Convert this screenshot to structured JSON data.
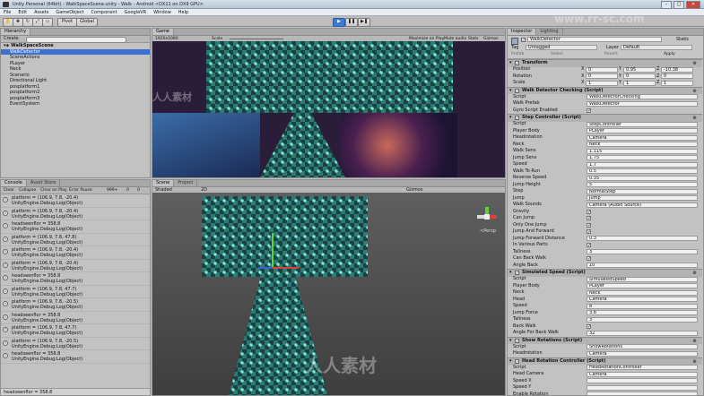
{
  "window": {
    "title": "Unity Personal (64bit) - WalkSpaceScene.unity - Walk - Android <DX11 on DX9 GPU>"
  },
  "menu": [
    "File",
    "Edit",
    "Assets",
    "GameObject",
    "Component",
    "GoogleVR",
    "Window",
    "Help"
  ],
  "toolbar": {
    "pivot": "Pivot",
    "global": "Global",
    "layers": "Layers",
    "layout": "Layout"
  },
  "hierarchy": {
    "tab": "Hierarchy",
    "create": "Create",
    "scene": "WalkSpaceScene",
    "items": [
      "WalkDetector",
      "SceneActions",
      "PLayer",
      "Neck",
      "Scenario",
      "Directional Light",
      "posplatform1",
      "posplatform2",
      "posplatform3",
      "EventSystem"
    ]
  },
  "game": {
    "tab": "Game",
    "display": "Display 1",
    "res": "1920x1080",
    "scale": "Scale",
    "maximize": "Maximize on Play",
    "mute": "Mute audio",
    "stats": "Stats",
    "gizmos": "Gizmos"
  },
  "scene_view": {
    "tab": "Scene",
    "tab2": "Project",
    "shaded": "Shaded",
    "mode": "2D",
    "gizmos": "Gizmos",
    "persp": "<Persp"
  },
  "console": {
    "tab": "Console",
    "tab2": "Asset Store",
    "buttons": [
      "Clear",
      "Collapse",
      "Clear on Play",
      "Error Pause"
    ],
    "counts": [
      "999+",
      "0",
      "0"
    ],
    "entries": [
      {
        "a": "platform = (106.9, 7.8, -20.4)",
        "b": "UnityEngine.Debug:Log(Object)"
      },
      {
        "a": "platform = (106.9, 7.8, -20.4)",
        "b": "UnityEngine.Debug:Log(Object)"
      },
      {
        "a": "headseenflor = 358.8",
        "b": "UnityEngine.Debug:Log(Object)"
      },
      {
        "a": "platform = (106.9, 7.8, 47.8)",
        "b": "UnityEngine.Debug:Log(Object)"
      },
      {
        "a": "platform = (106.9, 7.8, -20.4)",
        "b": "UnityEngine.Debug:Log(Object)"
      },
      {
        "a": "platform = (106.9, 7.8, -20.4)",
        "b": "UnityEngine.Debug:Log(Object)"
      },
      {
        "a": "headseenflor = 358.8",
        "b": "UnityEngine.Debug:Log(Object)"
      },
      {
        "a": "platform = (106.9, 7.8, 47.7)",
        "b": "UnityEngine.Debug:Log(Object)"
      },
      {
        "a": "platform = (106.9, 7.8, -20.5)",
        "b": "UnityEngine.Debug:Log(Object)"
      },
      {
        "a": "headseenflor = 358.8",
        "b": "UnityEngine.Debug:Log(Object)"
      },
      {
        "a": "platform = (106.9, 7.8, 47.7)",
        "b": "UnityEngine.Debug:Log(Object)"
      },
      {
        "a": "platform = (106.9, 7.8, -20.5)",
        "b": "UnityEngine.Debug:Log(Object)"
      },
      {
        "a": "headseenflor = 358.8",
        "b": "UnityEngine.Debug:Log(Object)"
      }
    ],
    "status": "headseenflor = 358.8"
  },
  "inspector": {
    "tab": "Inspector",
    "tab2": "Lighting",
    "object": "WalkDetector",
    "static": "Static",
    "tag_label": "Tag",
    "tag": "Untagged",
    "layer_label": "Layer",
    "layer": "Default",
    "prefab": "Prefab",
    "select": "Select",
    "revert": "Revert",
    "apply": "Apply",
    "transform": {
      "title": "Transform",
      "rows": [
        {
          "label": "Position",
          "x": "0",
          "y": "0.95",
          "z": "-10.38"
        },
        {
          "label": "Rotation",
          "x": "0",
          "y": "0",
          "z": "0"
        },
        {
          "label": "Scale",
          "x": "1",
          "y": "1",
          "z": "1"
        }
      ]
    },
    "walk_detector": {
      "title": "Walk Detector Checking (Script)",
      "rows": [
        {
          "label": "Script",
          "value": "WalkDetectorChecking"
        },
        {
          "label": "Walk Prefab",
          "value": "WalkDetector"
        },
        {
          "label": "Gyro Script Enabled",
          "value": "✓"
        }
      ]
    },
    "step_controller": {
      "title": "Step Controller (Script)",
      "rows": [
        {
          "label": "Script",
          "value": "StepController"
        },
        {
          "label": "Player Body",
          "value": "PLayer"
        },
        {
          "label": "Headrotation",
          "value": "Camera"
        },
        {
          "label": "Neck",
          "value": "Neck"
        },
        {
          "label": "Walk Sens",
          "value": "1.115"
        },
        {
          "label": "Jump Sens",
          "value": "1.75"
        },
        {
          "label": "Speed",
          "value": "1.7"
        },
        {
          "label": "Walk To Run",
          "value": "0.5"
        },
        {
          "label": "Reverse Speed",
          "value": "0.35"
        },
        {
          "label": "Jump Height",
          "value": "5"
        },
        {
          "label": "Step",
          "value": "NormalStep"
        },
        {
          "label": "Jump",
          "value": "Jump"
        },
        {
          "label": "Walk Sounds",
          "value": "Camera (Audio Source)"
        },
        {
          "label": "Gravity",
          "value": "✓"
        },
        {
          "label": "Can Jump",
          "value": "✓"
        },
        {
          "label": "Only One Jump",
          "value": "✓"
        },
        {
          "label": "Jump And Forward",
          "value": "✓"
        },
        {
          "label": "Jump Forward Distance",
          "value": "0.3"
        },
        {
          "label": "In Various Parts",
          "value": "✓"
        },
        {
          "label": "Tallness",
          "value": "3"
        },
        {
          "label": "Can Back Walk",
          "value": "✓"
        },
        {
          "label": "Angle Back",
          "value": "10"
        }
      ]
    },
    "simulated_speed": {
      "title": "Simulated Speed (Script)",
      "rows": [
        {
          "label": "Script",
          "value": "SimulatedSpeed"
        },
        {
          "label": "Player Body",
          "value": "PLayer"
        },
        {
          "label": "Neck",
          "value": "Neck"
        },
        {
          "label": "Head",
          "value": "Camera"
        },
        {
          "label": "Speed",
          "value": "8"
        },
        {
          "label": "Jump Force",
          "value": "3.8"
        },
        {
          "label": "Tallness",
          "value": "3"
        },
        {
          "label": "Back Walk",
          "value": "✓"
        },
        {
          "label": "Angle For Back Walk",
          "value": "32"
        }
      ]
    },
    "show_rotations": {
      "title": "Show Rotations (Script)",
      "rows": [
        {
          "label": "Script",
          "value": "ShowRotations"
        },
        {
          "label": "Headrotation",
          "value": "Camera"
        }
      ]
    },
    "head_rotation": {
      "title": "Head Rotation Controller (Script)",
      "rows": [
        {
          "label": "Script",
          "value": "HeadRotationController"
        },
        {
          "label": "Head Camera",
          "value": "Camera"
        },
        {
          "label": "Speed X",
          "value": ""
        },
        {
          "label": "Speed Y",
          "value": ""
        },
        {
          "label": "Enable Rotation",
          "value": ""
        }
      ]
    }
  },
  "watermark": {
    "top": "www.rr-sc.com",
    "brand": "人人素材",
    "mid": "人人素材"
  }
}
